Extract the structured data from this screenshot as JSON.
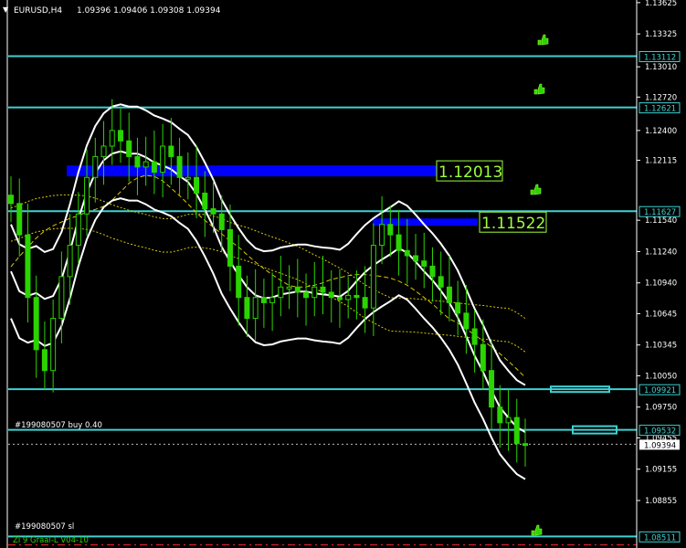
{
  "header": {
    "menu_glyph": "▼",
    "symbol_info": "EURUSD,H4",
    "ohlc": "1.09396 1.09406 1.09308 1.09394"
  },
  "indicator_label": "Zi 9 Graal-L V04-10",
  "order_labels": {
    "buy": "#199080507 buy 0.40",
    "sl": "#199080507 sl"
  },
  "colors": {
    "background": "#000000",
    "level_line": "#3fd1d1",
    "candle": "#2bd400",
    "band": "#ffffff",
    "ma": "#d9c800",
    "zone": "#0000ff",
    "zone_label": "#9cff3c",
    "sl_line": "#ff2a2a"
  },
  "icons": [
    "thumbs-up-icon"
  ],
  "chart_data": {
    "type": "candlestick",
    "symbol": "EURUSD",
    "timeframe": "H4",
    "ylim": [
      1.084,
      1.1365
    ],
    "price_ticks": [
      1.13625,
      1.13325,
      1.1301,
      1.1272,
      1.124,
      1.12115,
      1.1154,
      1.1124,
      1.1094,
      1.10645,
      1.10345,
      1.1005,
      1.0975,
      1.09455,
      1.09155,
      1.08855
    ],
    "price_tick_labels": [
      "1.13625",
      "1.13325",
      "1.13010",
      "1.12720",
      "1.12400",
      "1.12115",
      "1.11540",
      "1.11240",
      "1.10940",
      "1.10645",
      "1.10345",
      "1.10050",
      "1.09750",
      "1.09455",
      "1.09155",
      "1.08855"
    ],
    "horizontal_levels": [
      {
        "price": 1.13112,
        "label": "1.13112"
      },
      {
        "price": 1.12621,
        "label": "1.12621"
      },
      {
        "price": 1.11627,
        "label": "1.11627"
      },
      {
        "price": 1.09921,
        "label": "1.09921"
      },
      {
        "price": 1.09532,
        "label": "1.09532"
      },
      {
        "price": 1.08511,
        "label": "1.08511"
      }
    ],
    "current_price": {
      "price": 1.09394,
      "label": "1.09394"
    },
    "order_buy_price": 1.09394,
    "order_sl_price": 1.0843,
    "zones": [
      {
        "price": 1.12013,
        "label": "1.12013"
      },
      {
        "price": 1.11522,
        "label": "1.11522"
      }
    ],
    "close_series": [
      1.117,
      1.114,
      1.108,
      1.103,
      1.101,
      1.106,
      1.11,
      1.113,
      1.116,
      1.1195,
      1.1215,
      1.1225,
      1.124,
      1.123,
      1.1215,
      1.1205,
      1.121,
      1.12,
      1.1225,
      1.1215,
      1.1195,
      1.1195,
      1.118,
      1.1165,
      1.116,
      1.1145,
      1.111,
      1.108,
      1.106,
      1.108,
      1.1075,
      1.108,
      1.109,
      1.109,
      1.1085,
      1.108,
      1.109,
      1.1085,
      1.108,
      1.1078,
      1.1082,
      1.108,
      1.107,
      1.113,
      1.115,
      1.114,
      1.1125,
      1.112,
      1.1115,
      1.111,
      1.11,
      1.109,
      1.1075,
      1.1065,
      1.105,
      1.1035,
      1.101,
      1.0975,
      1.096,
      1.0965,
      1.094,
      1.0939
    ]
  }
}
